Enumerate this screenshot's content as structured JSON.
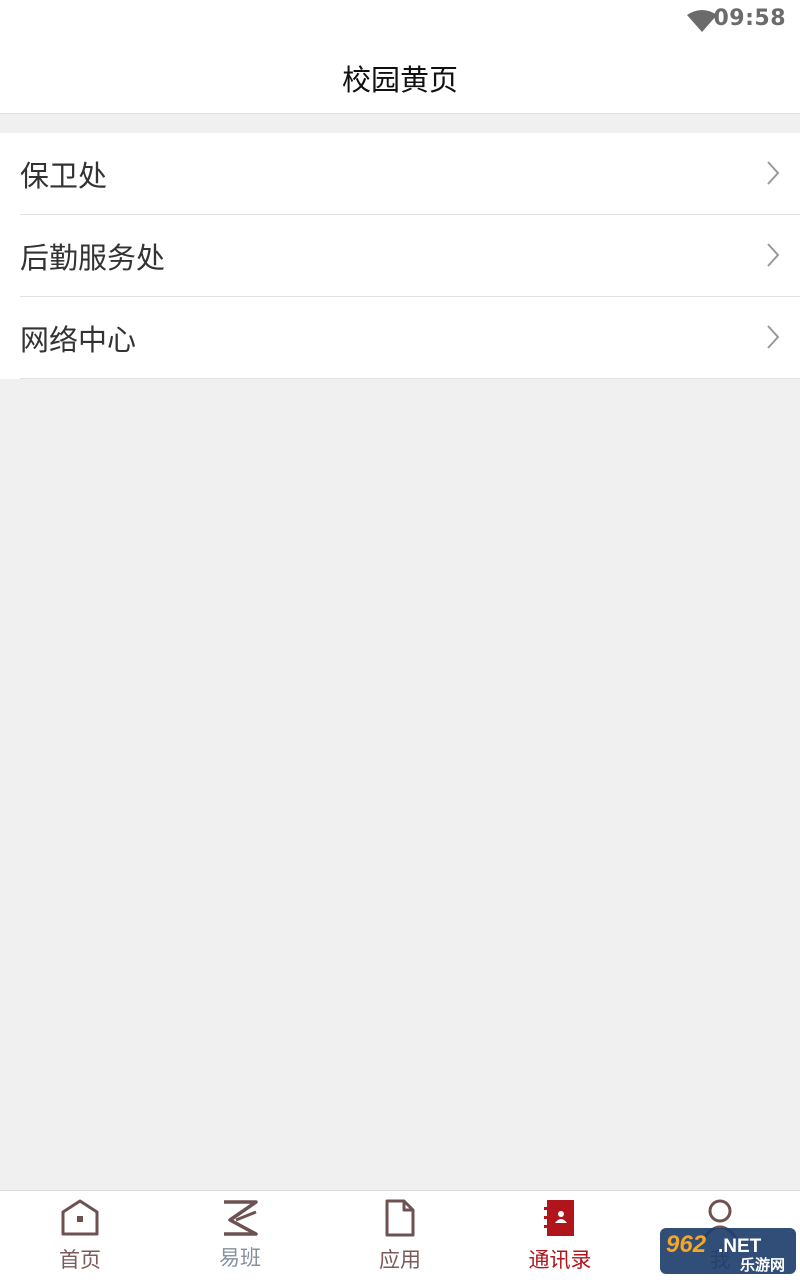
{
  "status_bar": {
    "time": "09:58",
    "wifi_icon": "wifi-icon"
  },
  "header": {
    "title": "校园黄页"
  },
  "directory": {
    "items": [
      {
        "label": "保卫处",
        "icon": "chevron-right-icon"
      },
      {
        "label": "后勤服务处",
        "icon": "chevron-right-icon"
      },
      {
        "label": "网络中心",
        "icon": "chevron-right-icon"
      }
    ]
  },
  "tab_bar": {
    "active_tab": "通讯录",
    "active_color": "#b0151c",
    "inactive_color": "#7a5a5a",
    "tabs": [
      {
        "label": "首页",
        "icon": "home-icon"
      },
      {
        "label": "易班",
        "icon": "yiban-logo-icon"
      },
      {
        "label": "应用",
        "icon": "document-icon"
      },
      {
        "label": "通讯录",
        "icon": "contacts-book-icon"
      },
      {
        "label": "我",
        "icon": "person-icon"
      }
    ]
  },
  "watermark": {
    "brand": "962.NET",
    "subtitle": "乐游网"
  }
}
